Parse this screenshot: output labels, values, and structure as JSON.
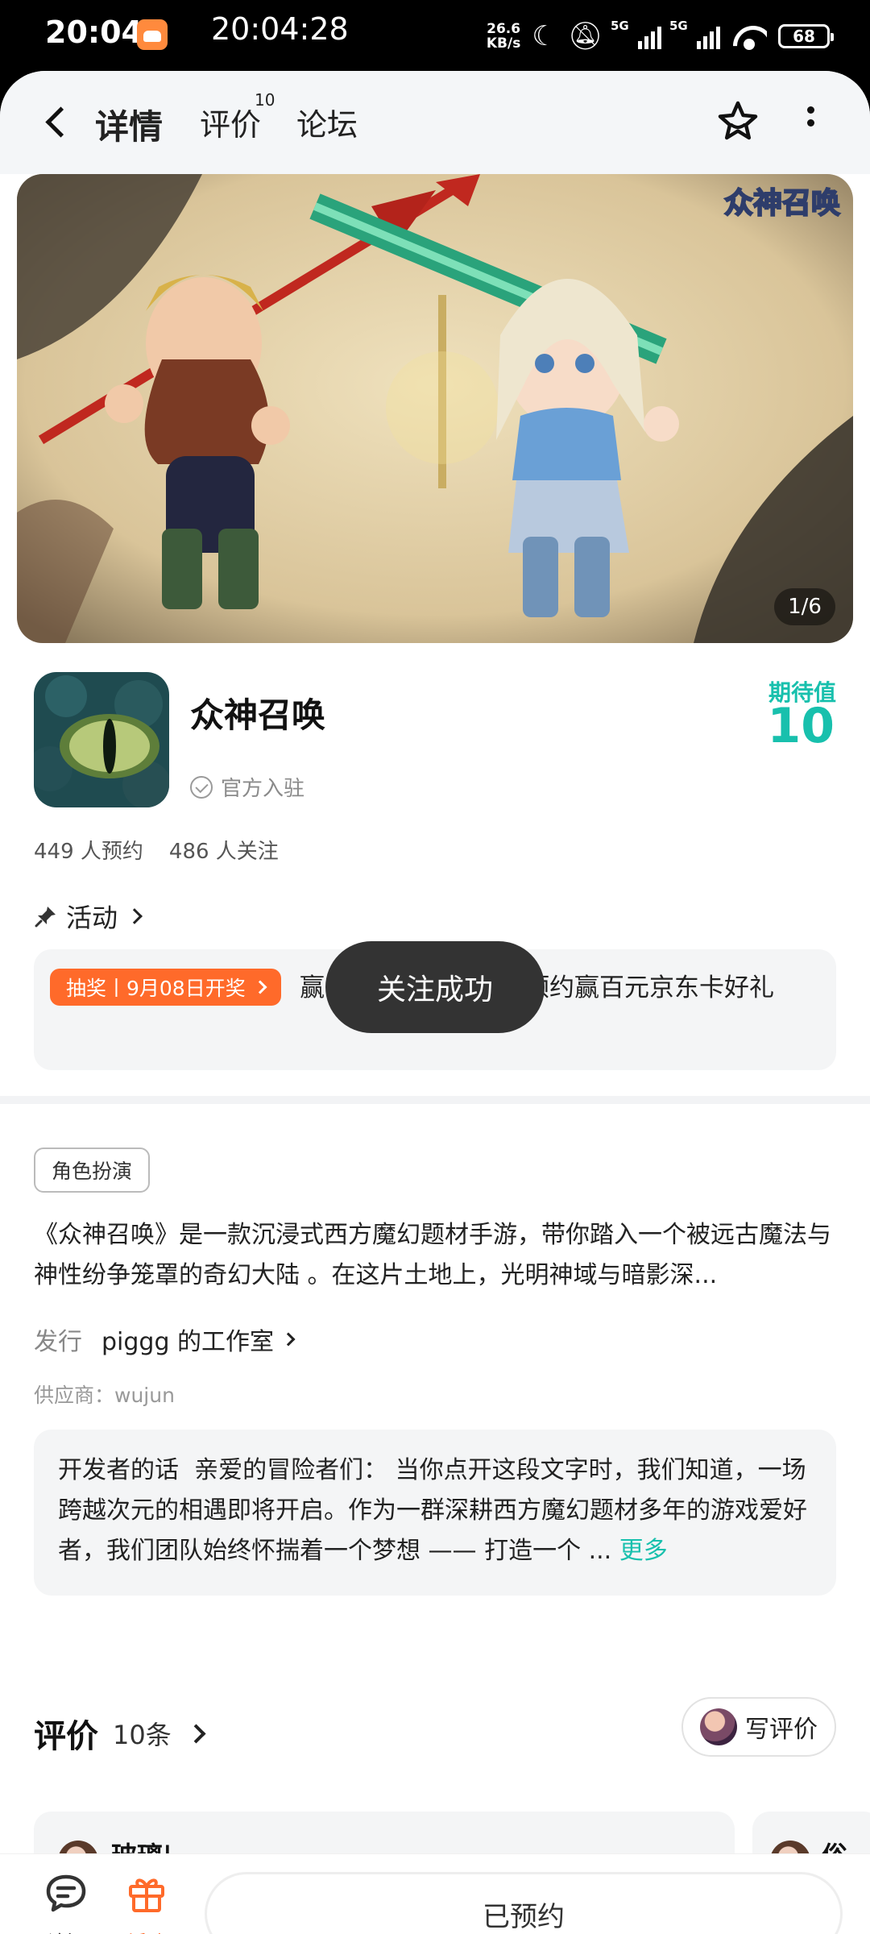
{
  "status_bar": {
    "time": "20:04",
    "clock": "20:04:28",
    "net_speed_value": "26.6",
    "net_speed_unit": "KB/s",
    "signal1": "5G",
    "signal2": "5G",
    "battery": "68"
  },
  "tabs": {
    "detail": "详情",
    "review": "评价",
    "review_count": "10",
    "forum": "论坛"
  },
  "banner": {
    "logo_text": "众神召唤",
    "counter": "1/6"
  },
  "game": {
    "title": "众神召唤",
    "official_label": "官方入驻",
    "expect_label": "期待值",
    "expect_value": "10",
    "reservations": "449 人预约",
    "followers": "486 人关注"
  },
  "activity": {
    "heading": "活动",
    "badge": "抽奖丨9月08日开奖",
    "text": "赢【众神召唤来袭】预约赢百元京东卡好礼"
  },
  "toast": "关注成功",
  "info": {
    "genre": "角色扮演",
    "description": "《众神召唤》是一款沉浸式西方魔幻题材手游，带你踏入一个被远古魔法与神性纷争笼罩的奇幻大陆 。在这片土地上，光明神域与暗影深...",
    "publisher_label": "发行",
    "publisher": "piggg 的工作室",
    "supplier": "供应商：wujun"
  },
  "dev_words": {
    "label": "开发者的话",
    "text": "亲爱的冒险者们： 当你点开这段文字时，我们知道，一场跨越次元的相遇即将开启。作为一群深耕西方魔幻题材多年的游戏爱好者，我们团队始终怀揣着一个梦想 —— 打造一个 ...",
    "more": "更多"
  },
  "reviews": {
    "title": "评价",
    "count": "10条",
    "write_label": "写评价",
    "first_reviewer": "玻璃|...",
    "second_reviewer": "俗..."
  },
  "bottom_nav": {
    "forum": "论坛",
    "activity": "活动",
    "reserved": "已预约"
  },
  "colors": {
    "accent": "#18c0ad",
    "orange": "#ff6a2a"
  }
}
